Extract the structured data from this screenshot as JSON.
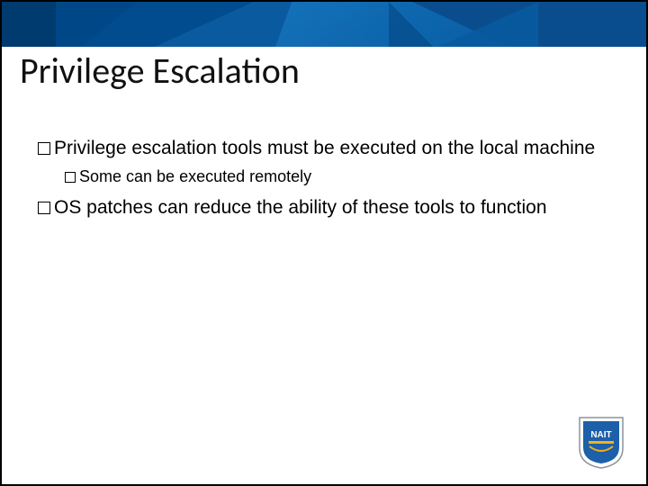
{
  "slide": {
    "title": "Privilege Escalation",
    "bullets": {
      "b1": "Privilege escalation tools must be executed on the local machine",
      "b1_sub1": "Some can be executed remotely",
      "b2": "OS patches can reduce the ability of these tools to function"
    }
  },
  "branding": {
    "institution": "NAIT"
  },
  "colors": {
    "header_base": "#0a5aa0",
    "header_dark": "#003b70",
    "shield_blue": "#1d5fa8",
    "shield_border": "#8a939c"
  }
}
